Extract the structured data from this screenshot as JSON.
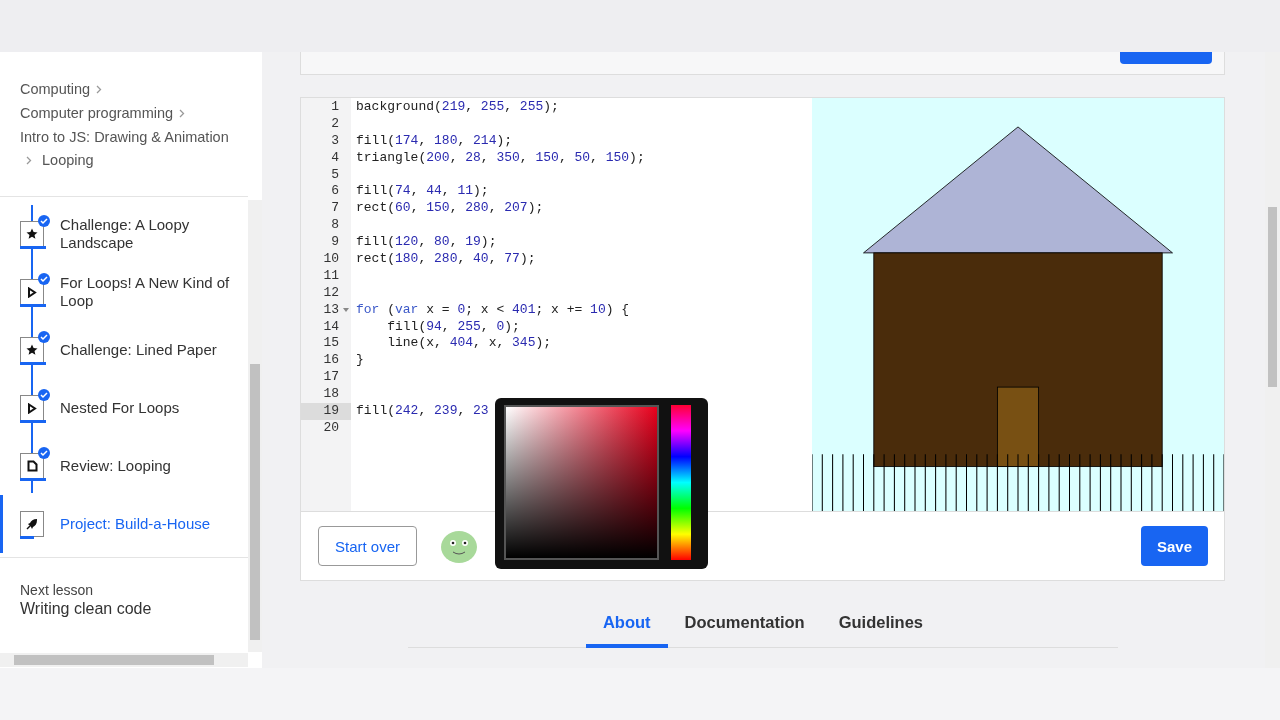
{
  "sidebar": {
    "breadcrumb": [
      "Computing",
      "Computer programming",
      "Intro to JS: Drawing & Animation",
      "Looping"
    ],
    "lessons": [
      {
        "title": "Challenge: A Loopy Landscape",
        "kind": "challenge",
        "completed": true,
        "selected": false
      },
      {
        "title": "For Loops! A New Kind of Loop",
        "kind": "video",
        "completed": true,
        "selected": false
      },
      {
        "title": "Challenge: Lined Paper",
        "kind": "challenge",
        "completed": true,
        "selected": false
      },
      {
        "title": "Nested For Loops",
        "kind": "video",
        "completed": true,
        "selected": false
      },
      {
        "title": "Review: Looping",
        "kind": "article",
        "completed": true,
        "selected": false
      },
      {
        "title": "Project: Build-a-House",
        "kind": "project",
        "completed": false,
        "selected": true
      }
    ],
    "next_lesson": {
      "label": "Next lesson",
      "title": "Writing clean code"
    }
  },
  "editor": {
    "lines": [
      {
        "number": "1",
        "code": "background(219, 255, 255);",
        "highlighted": false,
        "foldable": false
      },
      {
        "number": "2",
        "highlighted": false,
        "foldable": false
      },
      {
        "number": "3",
        "code": "fill(174, 180, 214);",
        "highlighted": false,
        "foldable": false
      },
      {
        "number": "4",
        "code": "triangle(200, 28, 350, 150, 50, 150);",
        "highlighted": false,
        "foldable": false
      },
      {
        "number": "5",
        "highlighted": false,
        "foldable": false
      },
      {
        "number": "6",
        "code": "fill(74, 44, 11);",
        "highlighted": false,
        "foldable": false
      },
      {
        "number": "7",
        "code": "rect(60, 150, 280, 207);",
        "highlighted": false,
        "foldable": false
      },
      {
        "number": "8",
        "highlighted": false,
        "foldable": false
      },
      {
        "number": "9",
        "code": "fill(120, 80, 19);",
        "highlighted": false,
        "foldable": false
      },
      {
        "number": "10",
        "code": "rect(180, 280, 40, 77);",
        "highlighted": false,
        "foldable": false
      },
      {
        "number": "11",
        "highlighted": false,
        "foldable": false
      },
      {
        "number": "12",
        "highlighted": false,
        "foldable": false
      },
      {
        "number": "13",
        "code": "for (var x = 0; x < 401; x += 10) {",
        "highlighted": false,
        "foldable": true
      },
      {
        "number": "14",
        "code": "    fill(94, 255, 0);",
        "highlighted": false,
        "foldable": false
      },
      {
        "number": "15",
        "code": "    line(x, 404, x, 345);",
        "highlighted": false,
        "foldable": false
      },
      {
        "number": "16",
        "code": "}",
        "highlighted": false,
        "foldable": false
      },
      {
        "number": "17",
        "highlighted": false,
        "foldable": false
      },
      {
        "number": "18",
        "highlighted": false,
        "foldable": false
      },
      {
        "number": "19",
        "code": "fill(242, 239, 23",
        "highlighted": true,
        "foldable": false
      },
      {
        "number": "20",
        "highlighted": false,
        "foldable": false
      }
    ],
    "color_picker": {
      "open": true
    }
  },
  "toolbar": {
    "start_over": "Start over",
    "save": "Save"
  },
  "tabs": [
    {
      "label": "About",
      "selected": true
    },
    {
      "label": "Documentation",
      "selected": false
    },
    {
      "label": "Guidelines",
      "selected": false
    }
  ]
}
